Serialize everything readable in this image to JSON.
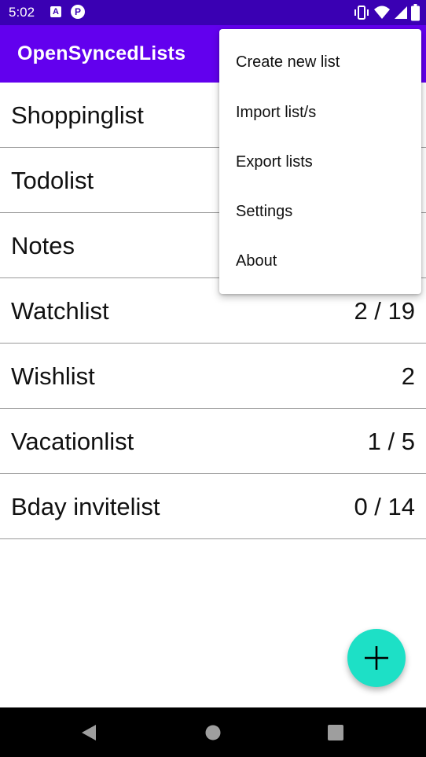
{
  "status_bar": {
    "time": "5:02",
    "icons": [
      "a-notification-icon",
      "p-notification-icon",
      "vibrate-icon",
      "wifi-icon",
      "signal-icon",
      "battery-icon"
    ],
    "a_glyph": "A",
    "p_glyph": "P",
    "background": "#3a00b3"
  },
  "app_bar": {
    "title": "OpenSyncedLists",
    "background": "#6200ee"
  },
  "lists": [
    {
      "name": "Shoppinglist",
      "count": ""
    },
    {
      "name": "Todolist",
      "count": ""
    },
    {
      "name": "Notes",
      "count": ""
    },
    {
      "name": "Watchlist",
      "count": "2 / 19"
    },
    {
      "name": "Wishlist",
      "count": "2"
    },
    {
      "name": "Vacationlist",
      "count": "1 / 5"
    },
    {
      "name": "Bday invitelist",
      "count": "0 / 14"
    }
  ],
  "overflow_menu": {
    "items": [
      {
        "label": "Create new list"
      },
      {
        "label": "Import list/s"
      },
      {
        "label": "Export lists"
      },
      {
        "label": "Settings"
      },
      {
        "label": "About"
      }
    ]
  },
  "fab": {
    "icon": "plus-icon",
    "color": "#1de0c6"
  },
  "nav_bar": {
    "icons": [
      "back-icon",
      "home-icon",
      "recents-icon"
    ]
  }
}
